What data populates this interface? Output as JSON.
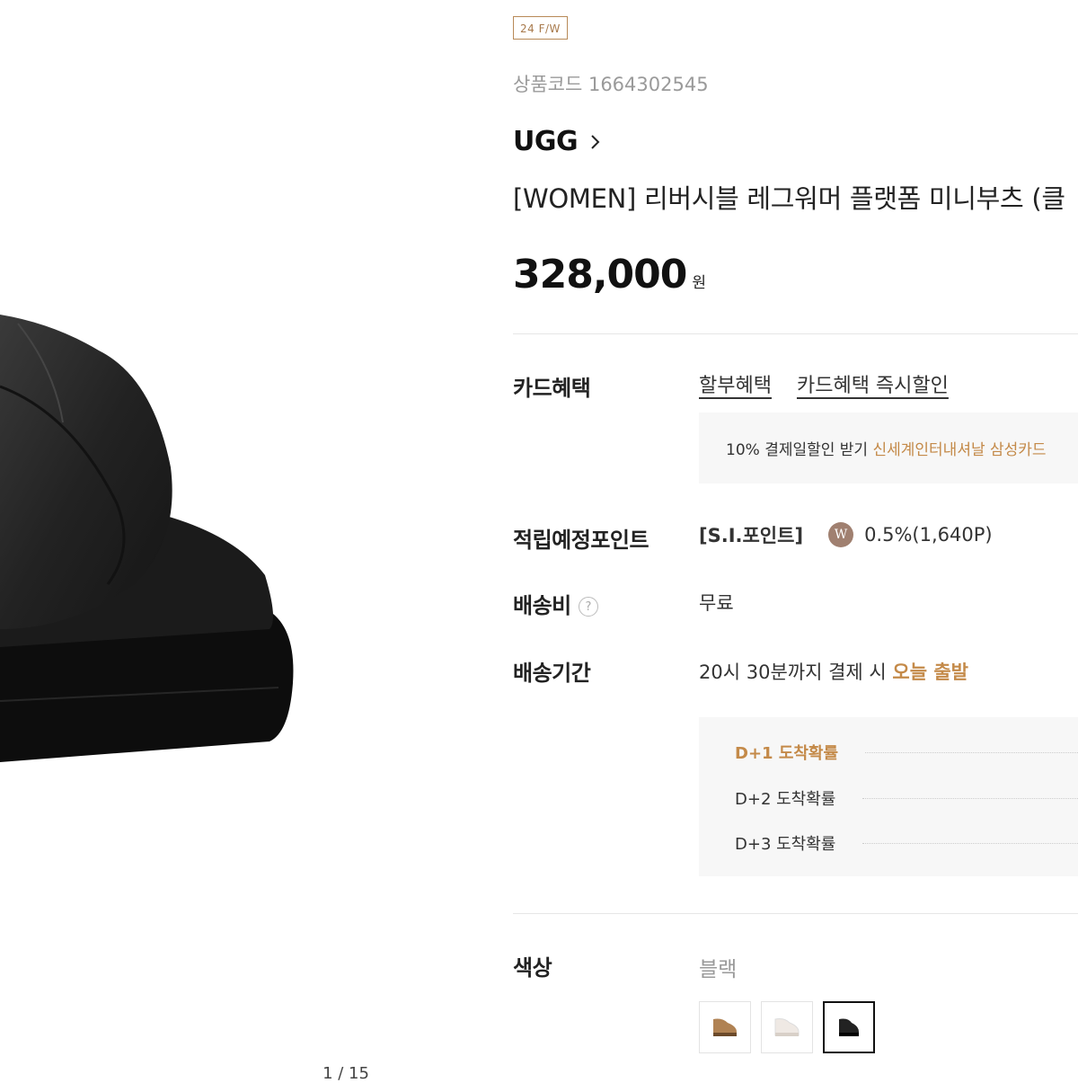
{
  "gallery": {
    "counter": "1 / 15"
  },
  "product": {
    "season_tag": "24 F/W",
    "code": "상품코드 1664302545",
    "brand": "UGG",
    "title": "[WOMEN] 리버시블 레그워머 플랫폼 미니부츠 (클",
    "price": "328,000",
    "price_unit": "원"
  },
  "card_benefits": {
    "label": "카드혜택",
    "links": [
      "할부혜택",
      "카드혜택 즉시할인"
    ],
    "promo_text": "10% 결제일할인 받기",
    "promo_highlight": "신세계인터내셔날 삼성카드"
  },
  "points": {
    "label": "적립예정포인트",
    "name": "[S.I.포인트]",
    "badge": "W",
    "value": "0.5%(1,640P)"
  },
  "shipping_fee": {
    "label": "배송비",
    "help_icon": "?",
    "value": "무료"
  },
  "shipping_period": {
    "label": "배송기간",
    "text": "20시 30분까지 결제 시",
    "highlight": "오늘 출발",
    "arrivals": [
      "D+1 도착확률",
      "D+2 도착확률",
      "D+3 도착확률"
    ]
  },
  "color": {
    "label": "색상",
    "selected": "블랙",
    "swatches": [
      "chestnut",
      "white",
      "black"
    ]
  },
  "colors": {
    "accent": "#c48a49",
    "tag_border": "#b88a58",
    "box_bg": "#f7f7f7"
  }
}
